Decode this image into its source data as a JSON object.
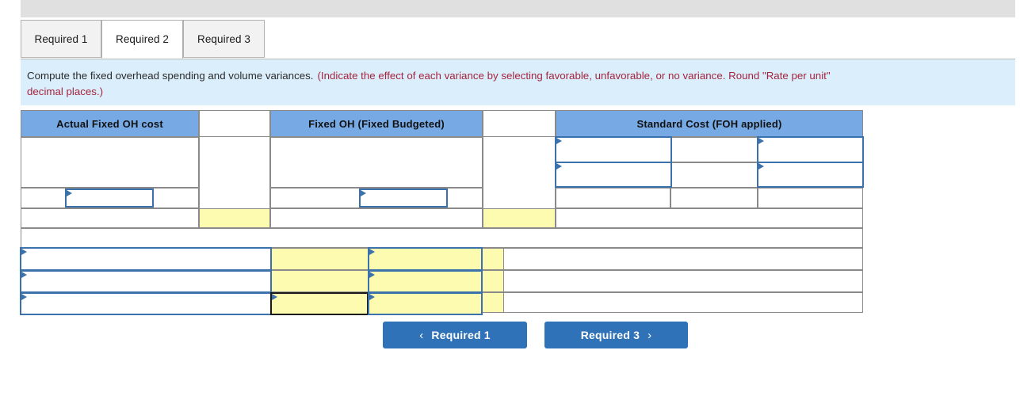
{
  "window": {
    "top_bar_color": "#e0e0e0"
  },
  "tabs": {
    "items": [
      {
        "id": "required-1",
        "label": "Required 1",
        "active": false
      },
      {
        "id": "required-2",
        "label": "Required 2",
        "active": true
      },
      {
        "id": "required-3",
        "label": "Required 3",
        "active": false
      }
    ]
  },
  "instructions": {
    "main": "Compute the fixed overhead spending and volume variances.",
    "note": "(Indicate the effect of each variance by selecting favorable, unfavorable, or no variance. Round \"Rate per unit\"",
    "note_line2": "decimal places.)",
    "panel_color": "#dbeefb",
    "note_color": "#a5243d"
  },
  "worksheet": {
    "header_color": "#77aae4",
    "highlight_color": "#fdfbb0",
    "entry_border_color": "#3c72ac",
    "columns": [
      {
        "id": "actual-fixed-oh-cost",
        "label": "Actual Fixed OH cost"
      },
      {
        "id": "spacer-1",
        "label": ""
      },
      {
        "id": "fixed-oh-budgeted",
        "label": "Fixed OH (Fixed Budgeted)"
      },
      {
        "id": "spacer-2",
        "label": ""
      },
      {
        "id": "standard-cost-foh-applied",
        "label": "Standard Cost (FOH applied)"
      }
    ],
    "entries": {
      "actual_fixed_oh": "",
      "fixed_oh_budgeted": "",
      "standard_cost_a1": "",
      "standard_cost_a2": "",
      "standard_cost_b1": "",
      "standard_cost_b2": "",
      "variance_label_1": "",
      "variance_label_2": "",
      "variance_label_3": "",
      "variance_amount_1": "",
      "variance_amount_2": "",
      "variance_amount_3": "",
      "variance_effect_1": "",
      "variance_effect_2": "",
      "variance_effect_3": ""
    }
  },
  "navigation": {
    "prev_label": "Required 1",
    "next_label": "Required 3",
    "prev_icon": "chevron-left-icon",
    "next_icon": "chevron-right-icon",
    "prev_chevron": "‹",
    "next_chevron": "›",
    "button_color": "#2f72b8"
  }
}
